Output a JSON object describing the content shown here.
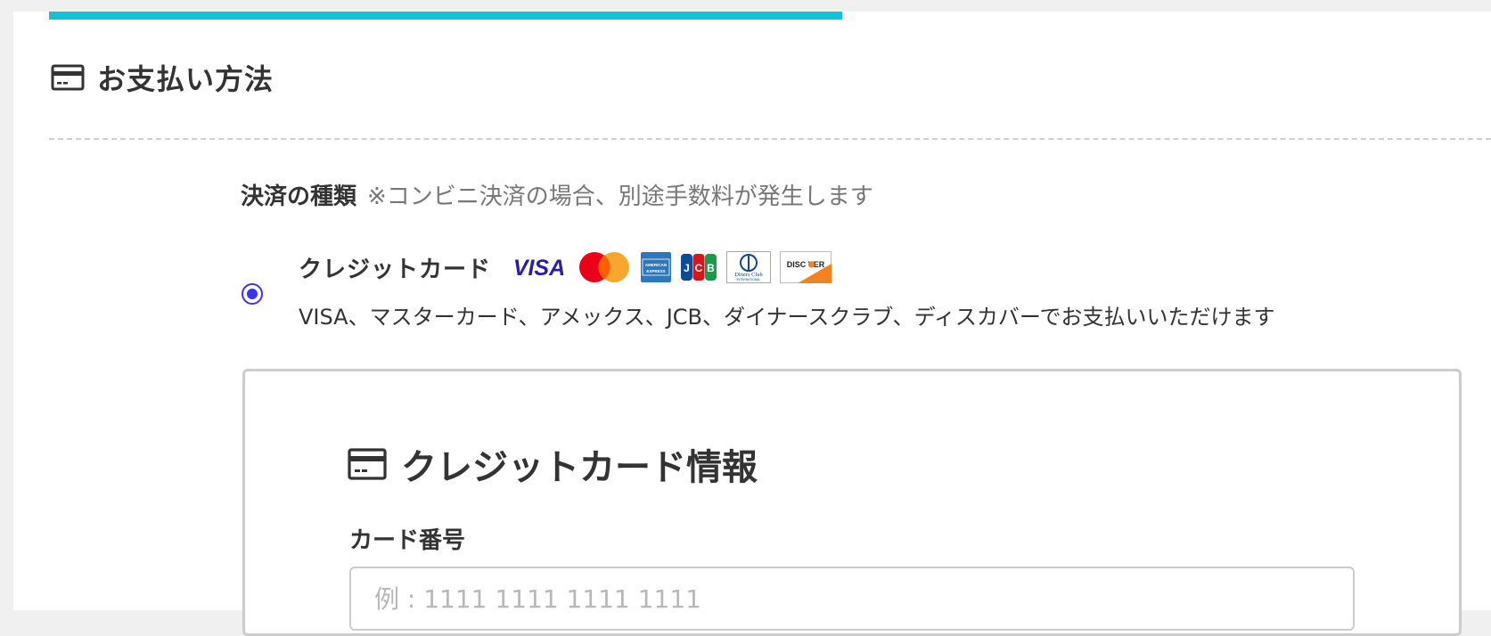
{
  "progress": {
    "fraction": 0.55,
    "color": "#13c3d3"
  },
  "section": {
    "title": "お支払い方法",
    "icon": "credit-card-icon"
  },
  "payment_type": {
    "label": "決済の種類",
    "note": "※コンビニ決済の場合、別途手数料が発生します"
  },
  "credit_option": {
    "selected": true,
    "label": "クレジットカード",
    "description": "VISA、マスターカード、アメックス、JCB、ダイナースクラブ、ディスカバーでお支払いいただけます",
    "brands": [
      {
        "name": "visa-logo",
        "text": "VISA"
      },
      {
        "name": "mastercard-logo",
        "text": ""
      },
      {
        "name": "amex-logo",
        "text": "AMERICAN EXPRESS"
      },
      {
        "name": "jcb-logo",
        "text": "JCB"
      },
      {
        "name": "diners-club-logo",
        "text": "Diners Club INTERNATIONAL"
      },
      {
        "name": "discover-logo",
        "text": "DISCOVER"
      }
    ]
  },
  "card_info": {
    "title": "クレジットカード情報",
    "icon": "credit-card-icon",
    "card_number": {
      "label": "カード番号",
      "value": "",
      "placeholder": "例 : 1111 1111 1111 1111"
    }
  },
  "colors": {
    "accent": "#13c3d3",
    "radio": "#3a35f0",
    "text": "#333333",
    "muted": "#777777"
  }
}
